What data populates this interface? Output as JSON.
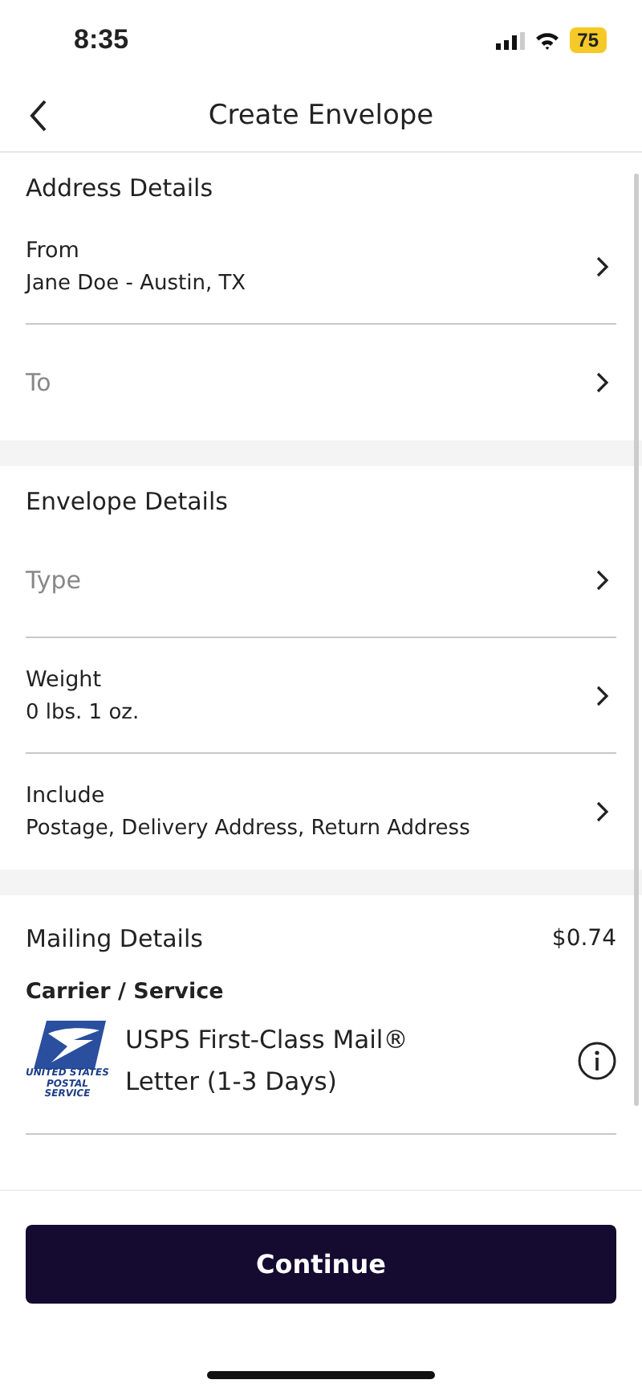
{
  "status_bar": {
    "time": "8:35",
    "battery": "75"
  },
  "header": {
    "title": "Create Envelope"
  },
  "sections": [
    {
      "title": "Address Details",
      "rows": [
        {
          "kind": "value",
          "label": "From",
          "value": "Jane Doe - Austin, TX"
        },
        {
          "kind": "placeholder",
          "label": "To"
        }
      ]
    },
    {
      "title": "Envelope Details",
      "rows": [
        {
          "kind": "placeholder",
          "label": "Type"
        },
        {
          "kind": "value",
          "label": "Weight",
          "value": "0 lbs.  1 oz."
        },
        {
          "kind": "value",
          "label": "Include",
          "value": "Postage, Delivery Address, Return Address"
        }
      ]
    }
  ],
  "mailing": {
    "title": "Mailing Details",
    "price": "$0.74",
    "carrier_label": "Carrier / Service",
    "logo_text": "UNITED STATES POSTAL SERVICE",
    "service": "USPS First-Class Mail®",
    "service_detail": "Letter (1-3 Days)"
  },
  "buttons": [
    "Continue"
  ]
}
